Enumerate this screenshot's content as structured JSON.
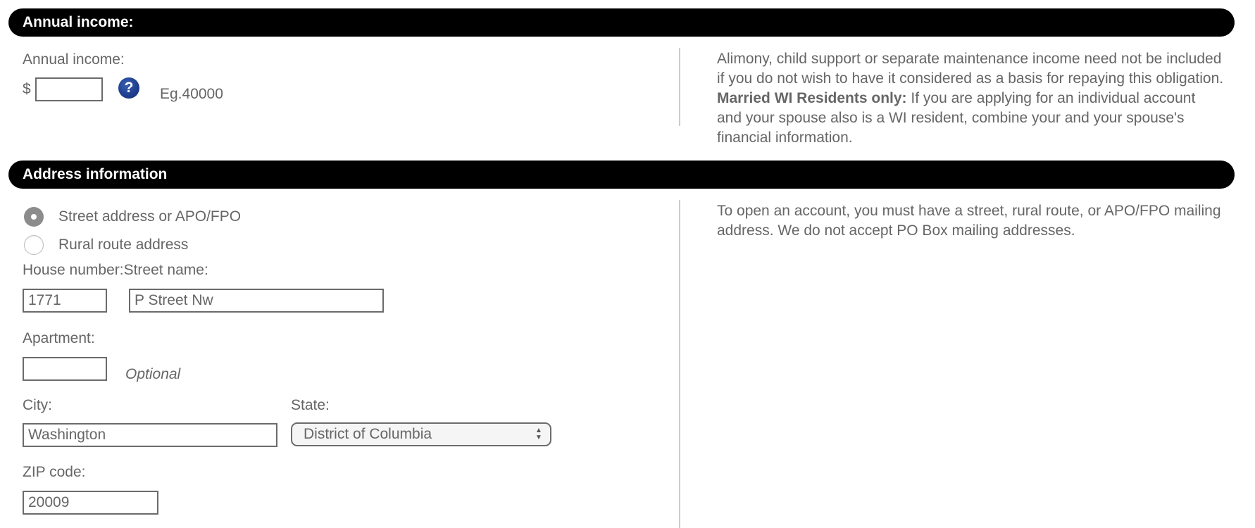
{
  "income_section": {
    "header": "Annual income:",
    "field_label": "Annual income:",
    "currency_symbol": "$",
    "income_value": "",
    "help_icon": "question-mark-help-icon",
    "help_glyph": "?",
    "example": "Eg.40000",
    "info_text_part1": "Alimony, child support or separate maintenance income need not be included if you do not wish to have it considered as a basis for repaying this obligation. ",
    "info_bold": "Married WI Residents only:",
    "info_text_part2": " If you are applying for an individual account and your spouse also is a WI resident, combine your and your spouse's financial information."
  },
  "address_section": {
    "header": "Address information",
    "address_type_options": [
      {
        "label": "Street address or APO/FPO",
        "selected": true
      },
      {
        "label": "Rural route address",
        "selected": false
      }
    ],
    "house_street_label": "House number:Street name:",
    "house_number_value": "1771",
    "street_name_value": "P Street Nw",
    "apartment_label": "Apartment:",
    "apartment_value": "",
    "apartment_hint": "Optional",
    "city_label": "City:",
    "city_value": "Washington",
    "state_label": "State:",
    "state_selected": "District of Columbia",
    "zip_label": "ZIP code:",
    "zip_value": "20009",
    "info_text": "To open an account, you must have a street, rural route, or APO/FPO mailing address. We do not accept PO Box mailing addresses."
  }
}
